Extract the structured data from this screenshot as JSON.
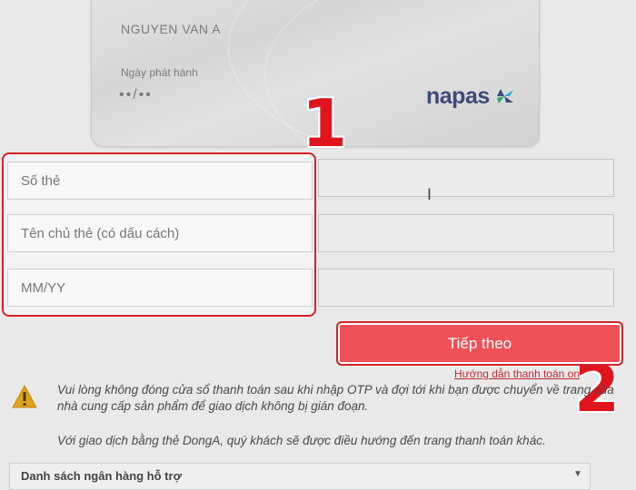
{
  "card": {
    "holder_name": "NGUYEN VAN A",
    "issue_date_label": "Ngày phát hành",
    "issue_date_value": "••/••",
    "brand": "napas"
  },
  "form": {
    "card_number_placeholder": "Số thẻ",
    "card_holder_placeholder": "Tên chủ thẻ (có dấu cách)",
    "expiry_placeholder": "MM/YY"
  },
  "markers": {
    "step1": "1",
    "step2": "2"
  },
  "next_button_label": "Tiếp theo",
  "guide_link": "Hướng dẫn thanh toán on",
  "notice": {
    "line1": "Vui lòng không đóng cửa sổ thanh toán sau khi nhập OTP và đợi tới khi bạn được chuyển về trang của nhà cung cấp sản phẩm để giao dịch không bị gián đoạn.",
    "line2": "Với giao dịch bằng thẻ DongA, quý khách sẽ được điều hướng đến trang thanh toán khác."
  },
  "bank_list_label": "Danh sách ngân hàng hỗ trợ",
  "colors": {
    "accent_red": "#d91f26",
    "button_red": "#ee5156",
    "napas_blue": "#3d4a7a"
  }
}
